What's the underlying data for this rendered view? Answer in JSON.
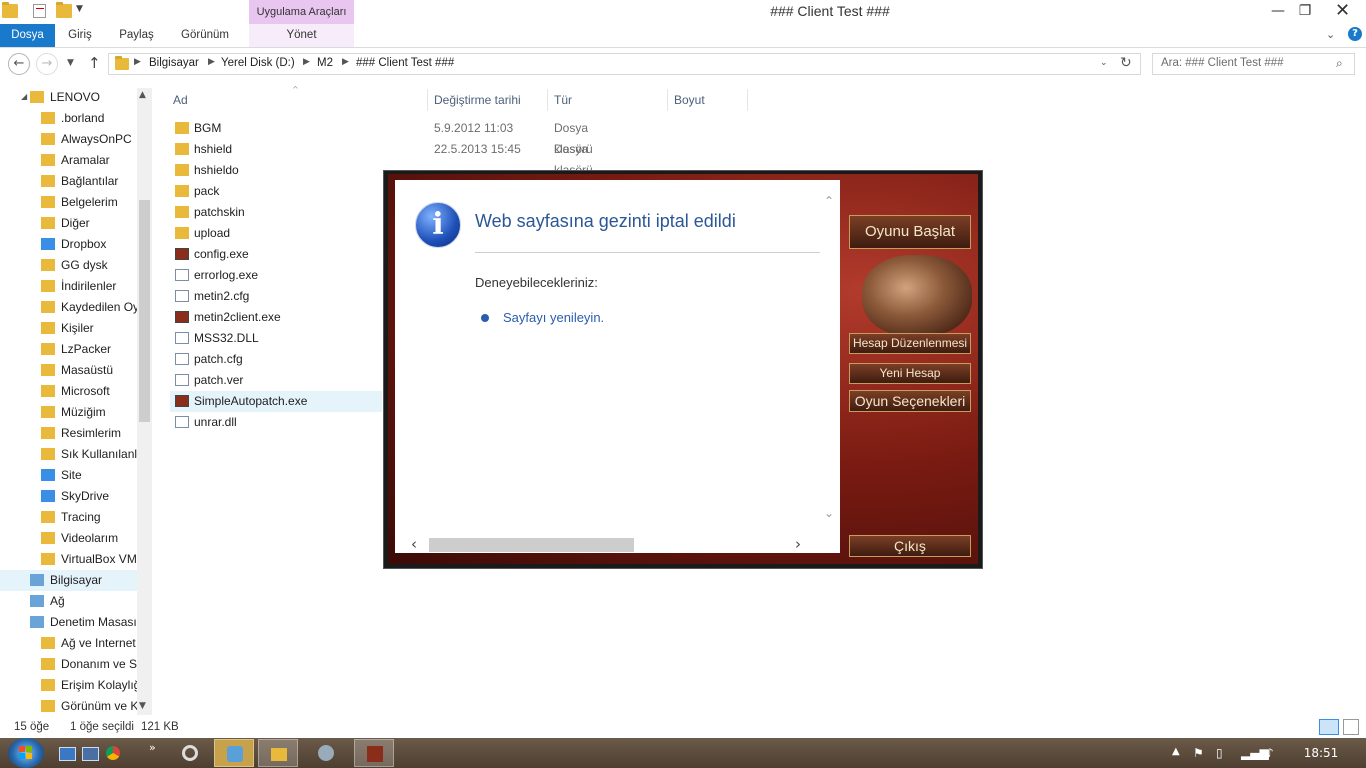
{
  "window": {
    "title": "###  Client Test ###",
    "context_header": "Uygulama Araçları",
    "controls": [
      "minimize",
      "maximize",
      "close"
    ]
  },
  "ribbon": {
    "tabs": [
      "Dosya",
      "Giriş",
      "Paylaş",
      "Görünüm"
    ],
    "context_tab": "Yönet"
  },
  "address": {
    "crumbs": [
      "Bilgisayar",
      "Yerel Disk (D:)",
      "M2",
      "###  Client Test ###"
    ]
  },
  "search": {
    "placeholder": "Ara: ###  Client Test ###"
  },
  "nav_pane": {
    "items": [
      {
        "label": "LENOVO",
        "icon": "user-folder-icon"
      },
      {
        "label": ".borland",
        "icon": "folder-icon"
      },
      {
        "label": "AlwaysOnPC",
        "icon": "folder-icon"
      },
      {
        "label": "Aramalar",
        "icon": "search-folder-icon"
      },
      {
        "label": "Bağlantılar",
        "icon": "links-folder-icon"
      },
      {
        "label": "Belgelerim",
        "icon": "documents-icon"
      },
      {
        "label": "Diğer",
        "icon": "folder-icon"
      },
      {
        "label": "Dropbox",
        "icon": "dropbox-icon"
      },
      {
        "label": "GG dysk",
        "icon": "folder-icon"
      },
      {
        "label": "İndirilenler",
        "icon": "downloads-icon"
      },
      {
        "label": "Kaydedilen Oy",
        "icon": "saved-games-icon"
      },
      {
        "label": "Kişiler",
        "icon": "contacts-icon"
      },
      {
        "label": "LzPacker",
        "icon": "folder-icon"
      },
      {
        "label": "Masaüstü",
        "icon": "desktop-icon"
      },
      {
        "label": "Microsoft",
        "icon": "folder-icon"
      },
      {
        "label": "Müziğim",
        "icon": "music-icon"
      },
      {
        "label": "Resimlerim",
        "icon": "pictures-icon"
      },
      {
        "label": "Sık Kullanılanla",
        "icon": "favorites-icon"
      },
      {
        "label": "Site",
        "icon": "site-icon"
      },
      {
        "label": "SkyDrive",
        "icon": "skydrive-icon"
      },
      {
        "label": "Tracing",
        "icon": "folder-icon"
      },
      {
        "label": "Videolarım",
        "icon": "videos-icon"
      },
      {
        "label": "VirtualBox VM",
        "icon": "folder-icon"
      },
      {
        "label": "Bilgisayar",
        "icon": "computer-icon"
      },
      {
        "label": "Ağ",
        "icon": "network-icon"
      },
      {
        "label": "Denetim Masası",
        "icon": "control-panel-icon"
      },
      {
        "label": "Ağ ve Internet",
        "icon": "network-internet-icon"
      },
      {
        "label": "Donanım ve Se",
        "icon": "hardware-icon"
      },
      {
        "label": "Erişim Kolaylığ",
        "icon": "accessibility-icon"
      },
      {
        "label": "Görünüm ve K",
        "icon": "appearance-icon"
      }
    ]
  },
  "file_list": {
    "columns": [
      "Ad",
      "Değiştirme tarihi",
      "Tür",
      "Boyut"
    ],
    "rows": [
      {
        "name": "BGM",
        "date": "5.9.2012 11:03",
        "type": "Dosya klasörü",
        "icon": "folder-icon"
      },
      {
        "name": "hshield",
        "date": "22.5.2013 15:45",
        "type": "Dosya klasörü",
        "icon": "folder-icon"
      },
      {
        "name": "hshieldo",
        "date": "",
        "type": "",
        "icon": "folder-icon"
      },
      {
        "name": "pack",
        "date": "",
        "type": "",
        "icon": "folder-icon"
      },
      {
        "name": "patchskin",
        "date": "",
        "type": "",
        "icon": "folder-icon"
      },
      {
        "name": "upload",
        "date": "",
        "type": "",
        "icon": "folder-icon"
      },
      {
        "name": "config.exe",
        "date": "",
        "type": "",
        "icon": "config-exe-icon"
      },
      {
        "name": "errorlog.exe",
        "date": "",
        "type": "",
        "icon": "exe-icon"
      },
      {
        "name": "metin2.cfg",
        "date": "",
        "type": "",
        "icon": "file-icon"
      },
      {
        "name": "metin2client.exe",
        "date": "",
        "type": "",
        "icon": "game-exe-icon"
      },
      {
        "name": "MSS32.DLL",
        "date": "",
        "type": "",
        "icon": "dll-icon"
      },
      {
        "name": "patch.cfg",
        "date": "",
        "type": "",
        "icon": "file-icon"
      },
      {
        "name": "patch.ver",
        "date": "",
        "type": "",
        "icon": "file-icon"
      },
      {
        "name": "SimpleAutopatch.exe",
        "date": "",
        "type": "",
        "icon": "game-exe-icon",
        "selected": true
      },
      {
        "name": "unrar.dll",
        "date": "",
        "type": "",
        "icon": "dll-icon"
      }
    ]
  },
  "status": {
    "item_count": "15 öğe",
    "selection": "1 öğe seçildi",
    "size": "121 KB"
  },
  "launcher": {
    "error_title": "Web sayfasına gezinti iptal edildi",
    "suggestions_label": "Deneyebilecekleriniz:",
    "suggestion_link": "Sayfayı yenileyin.",
    "buttons": {
      "start": "Oyunu Başlat",
      "account": "Hesap Düzenlenmesi",
      "new_account": "Yeni Hesap",
      "options": "Oyun Seçenekleri",
      "exit": "Çıkış"
    }
  },
  "taskbar": {
    "clock": "18:51"
  },
  "colors": {
    "file_tab": "#1979ca",
    "context_tab": "#e9c6f0",
    "link": "#2a5db0",
    "title_blue": "#2b5797"
  }
}
